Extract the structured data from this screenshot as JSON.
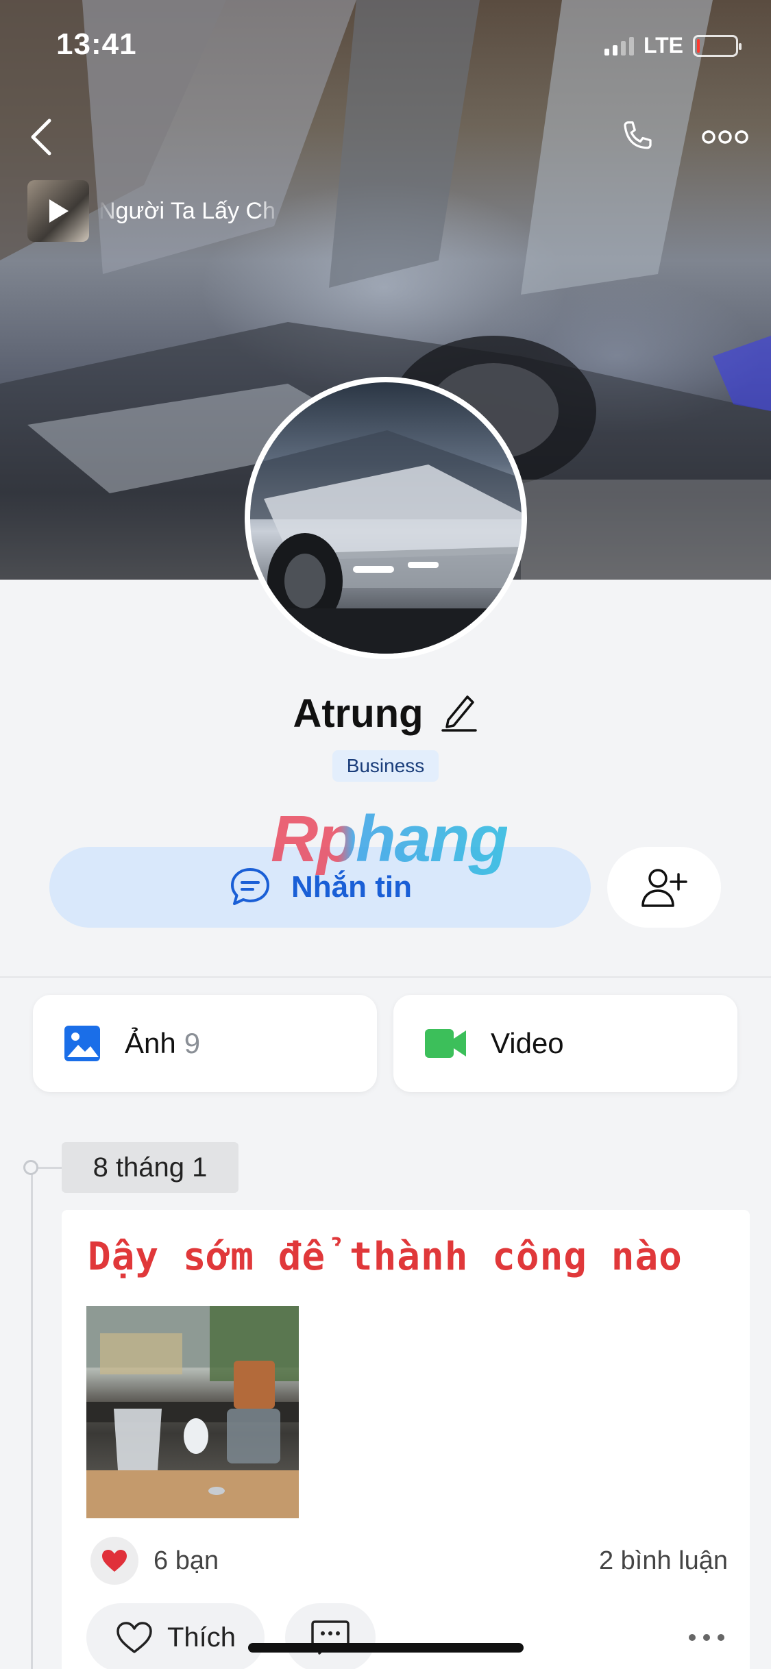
{
  "status_bar": {
    "time": "13:41",
    "network": "LTE",
    "battery_level": 0.08
  },
  "music": {
    "title": "Người Ta Lấy Ch"
  },
  "profile": {
    "name": "Atrung",
    "badge": "Business"
  },
  "watermark": "Rphang",
  "actions": {
    "message_label": "Nhắn tin"
  },
  "media_tiles": [
    {
      "label": "Ảnh",
      "count": "9",
      "icon": "image-icon",
      "color": "#1a6ee8"
    },
    {
      "label": "Video",
      "icon": "video-icon",
      "color": "#3cbf5a"
    }
  ],
  "timeline": {
    "date": "8 tháng 1"
  },
  "post": {
    "text": "Dậy sớm để thành công nào",
    "reaction_icon": "heart-icon",
    "reaction_count": "6 bạn",
    "comment_count": "2 bình luận",
    "like_label": "Thích"
  },
  "colors": {
    "accent": "#1a5fd6",
    "accent_bg": "#d9e8fb",
    "post_text": "#e0383a",
    "background": "#f3f4f6"
  }
}
